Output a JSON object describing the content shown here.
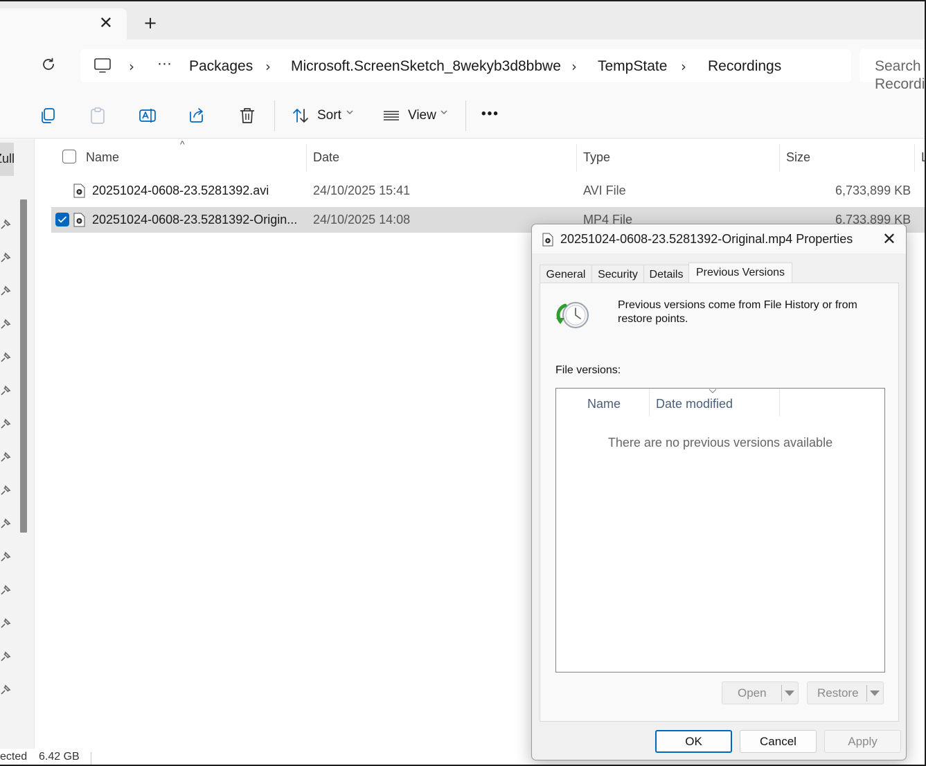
{
  "tabs": {
    "close_glyph": "✕",
    "new_tab_glyph": "+"
  },
  "address": {
    "ellipsis": "···",
    "crumbs": [
      "Packages",
      "Microsoft.ScreenSketch_8wekyb3d8bbwe",
      "TempState",
      "Recordings"
    ],
    "chevron": "›",
    "search_placeholder": "Search Recordings"
  },
  "commands": {
    "sort": "Sort",
    "view": "View",
    "more": "•••"
  },
  "leftnav": {
    "partial_label": "Zull"
  },
  "columns": {
    "name": "Name",
    "date": "Date",
    "type": "Type",
    "size": "Size",
    "extra": "L"
  },
  "files": [
    {
      "name": "20251024-0608-23.5281392.avi",
      "date": "24/10/2025 15:41",
      "type": "AVI File",
      "size": "6,733,899 KB",
      "selected": false
    },
    {
      "name": "20251024-0608-23.5281392-Origin...",
      "date": "24/10/2025 14:08",
      "type": "MP4 File",
      "size": "6,733,899 KB",
      "selected": true
    }
  ],
  "status": {
    "selected_text": "ected",
    "size_text": "6.42 GB"
  },
  "dialog": {
    "title": "20251024-0608-23.5281392-Original.mp4 Properties",
    "close_glyph": "✕",
    "tabs": [
      "General",
      "Security",
      "Details",
      "Previous Versions"
    ],
    "active_tab": "Previous Versions",
    "info": "Previous versions come from File History or from restore points.",
    "file_versions_label": "File versions:",
    "list_columns": [
      "Name",
      "Date modified"
    ],
    "empty_message": "There are no previous versions available",
    "open_label": "Open",
    "restore_label": "Restore",
    "ok": "OK",
    "cancel": "Cancel",
    "apply": "Apply"
  },
  "colors": {
    "accent": "#0067c0",
    "selection": "#dcdcdc",
    "dialog_bg": "#f0f0f0"
  }
}
